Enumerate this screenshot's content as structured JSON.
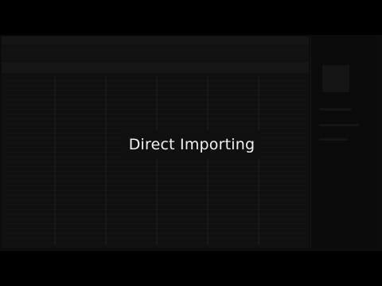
{
  "caption": {
    "text": "Direct Importing"
  }
}
